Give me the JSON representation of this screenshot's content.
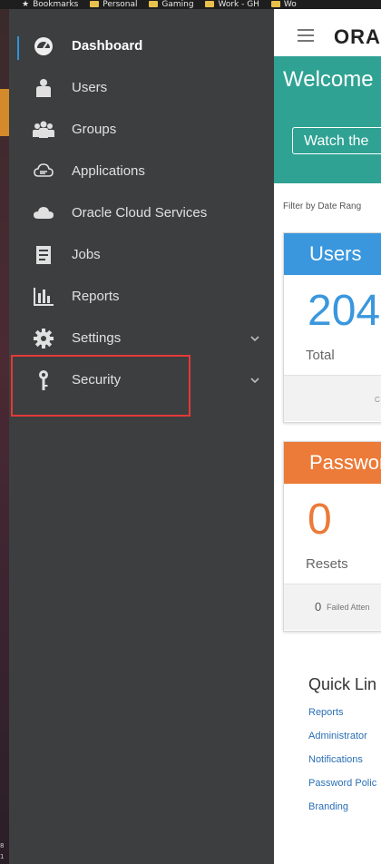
{
  "browser": {
    "bookmarks": [
      "Bookmarks",
      "Personal",
      "Gaming",
      "Work - GH",
      "Wo"
    ]
  },
  "desktop_edge": {
    "marks": [
      "8",
      "1"
    ]
  },
  "sidebar": {
    "items": [
      {
        "label": "Dashboard",
        "icon": "dashboard-icon",
        "active": true
      },
      {
        "label": "Users",
        "icon": "user-icon"
      },
      {
        "label": "Groups",
        "icon": "groups-icon"
      },
      {
        "label": "Applications",
        "icon": "applications-icon"
      },
      {
        "label": "Oracle Cloud Services",
        "icon": "cloud-icon"
      },
      {
        "label": "Jobs",
        "icon": "jobs-icon"
      },
      {
        "label": "Reports",
        "icon": "reports-icon"
      },
      {
        "label": "Settings",
        "icon": "gear-icon",
        "expandable": true
      },
      {
        "label": "Security",
        "icon": "key-icon",
        "expandable": true
      }
    ]
  },
  "header": {
    "brand": "ORA"
  },
  "welcome": {
    "title": "Welcome",
    "button": "Watch the"
  },
  "filter_label": "Filter by Date Rang",
  "cards": {
    "users": {
      "title": "Users",
      "value": "204",
      "sub": "Total",
      "footer": "C",
      "color": "#3a97dd"
    },
    "passwords": {
      "title": "Passwor",
      "value": "0",
      "sub": "Resets",
      "footer_value": "0",
      "footer_label": "Failed Atten",
      "color": "#ec7a38"
    }
  },
  "quick_links": {
    "title": "Quick Lin",
    "items": [
      "Reports",
      "Administrator",
      "Notifications",
      "Password Polic",
      "Branding"
    ]
  },
  "colors": {
    "sidebar_bg": "#3d3e40",
    "accent_blue": "#2f93d6",
    "welcome_teal": "#2fa293",
    "highlight_red": "#e53935"
  }
}
